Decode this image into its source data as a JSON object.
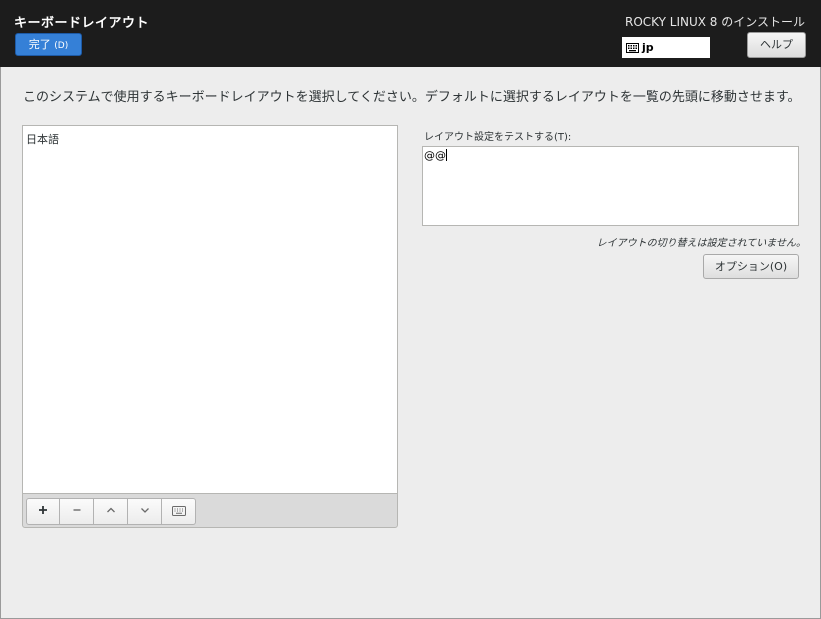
{
  "header": {
    "title": "キーボードレイアウト",
    "done_label": "完了",
    "done_accel": "(D)",
    "product": "ROCKY LINUX 8 のインストール",
    "keyboard_indicator": "jp",
    "help_label": "ヘルプ"
  },
  "description": "このシステムで使用するキーボードレイアウトを選択してください。デフォルトに選択するレイアウトを一覧の先頭に移動させます。",
  "layouts": {
    "items": [
      "日本語"
    ]
  },
  "toolbar": {
    "buttons": [
      "plus-icon",
      "minus-icon",
      "chevron-up-icon",
      "chevron-down-icon",
      "keyboard-icon"
    ]
  },
  "test": {
    "label": "レイアウト設定をテストする(T):",
    "value": "@@"
  },
  "switching_note": "レイアウトの切り替えは設定されていません。",
  "options_label": "オプション(O)"
}
